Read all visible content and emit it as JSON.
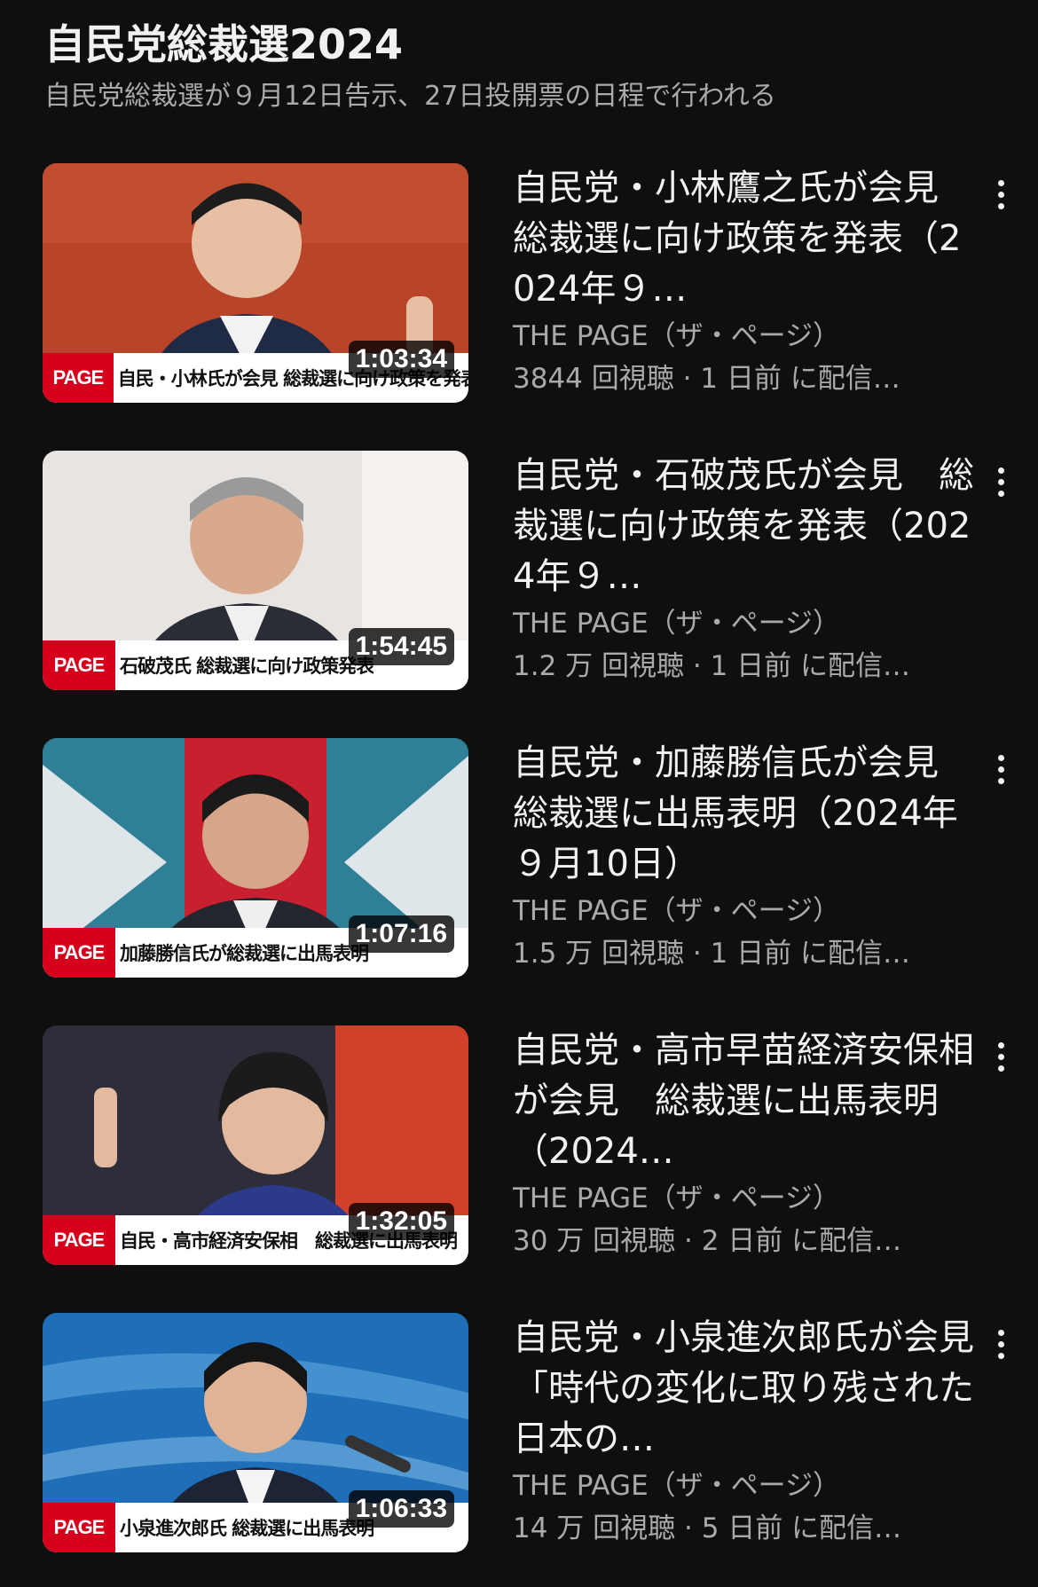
{
  "playlist": {
    "title": "自民党総裁選2024",
    "subtitle": "自民党総裁選が９月12日告示、27日投開票の日程で行われる"
  },
  "colors": {
    "background": "#0f0f0f",
    "text_primary": "#f1f1f1",
    "text_secondary": "#aaaaaa",
    "brand_red": "#d6001c"
  },
  "videos": [
    {
      "title": "自民党・小林鷹之氏が会見　総裁選に向け政策を発表（2024年９…",
      "channel": "THE PAGE（ザ・ページ）",
      "stats": "3844 回視聴 · 1 日前 に配信…",
      "duration": "1:03:34",
      "thumb_brand": "PAGE",
      "thumb_caption": "自民・小林氏が会見 総裁選に向け政策を発表",
      "thumb_background": "#b8452a"
    },
    {
      "title": "自民党・石破茂氏が会見　総裁選に向け政策を発表（2024年９…",
      "channel": "THE PAGE（ザ・ページ）",
      "stats": "1.2 万 回視聴 · 1 日前 に配信…",
      "duration": "1:54:45",
      "thumb_brand": "PAGE",
      "thumb_caption": "石破茂氏 総裁選に向け政策発表",
      "thumb_background": "#e8e4e2"
    },
    {
      "title": "自民党・加藤勝信氏が会見　総裁選に出馬表明（2024年９月10日）",
      "channel": "THE PAGE（ザ・ページ）",
      "stats": "1.5 万 回視聴 · 1 日前 に配信…",
      "duration": "1:07:16",
      "thumb_brand": "PAGE",
      "thumb_caption": "加藤勝信氏が総裁選に出馬表明",
      "thumb_background": "#2f7f96"
    },
    {
      "title": "自民党・高市早苗経済安保相が会見　総裁選に出馬表明（2024…",
      "channel": "THE PAGE（ザ・ページ）",
      "stats": "30 万 回視聴 · 2 日前 に配信…",
      "duration": "1:32:05",
      "thumb_brand": "PAGE",
      "thumb_caption": "自民・高市経済安保相　総裁選に出馬表明",
      "thumb_background": "#2e2e3a"
    },
    {
      "title": "自民党・小泉進次郎氏が会見「時代の変化に取り残された日本の…",
      "channel": "THE PAGE（ザ・ページ）",
      "stats": "14 万 回視聴 · 5 日前 に配信…",
      "duration": "1:06:33",
      "thumb_brand": "PAGE",
      "thumb_caption": "小泉進次郎氏 総裁選に出馬表明",
      "thumb_background": "#1f6fb8"
    }
  ]
}
